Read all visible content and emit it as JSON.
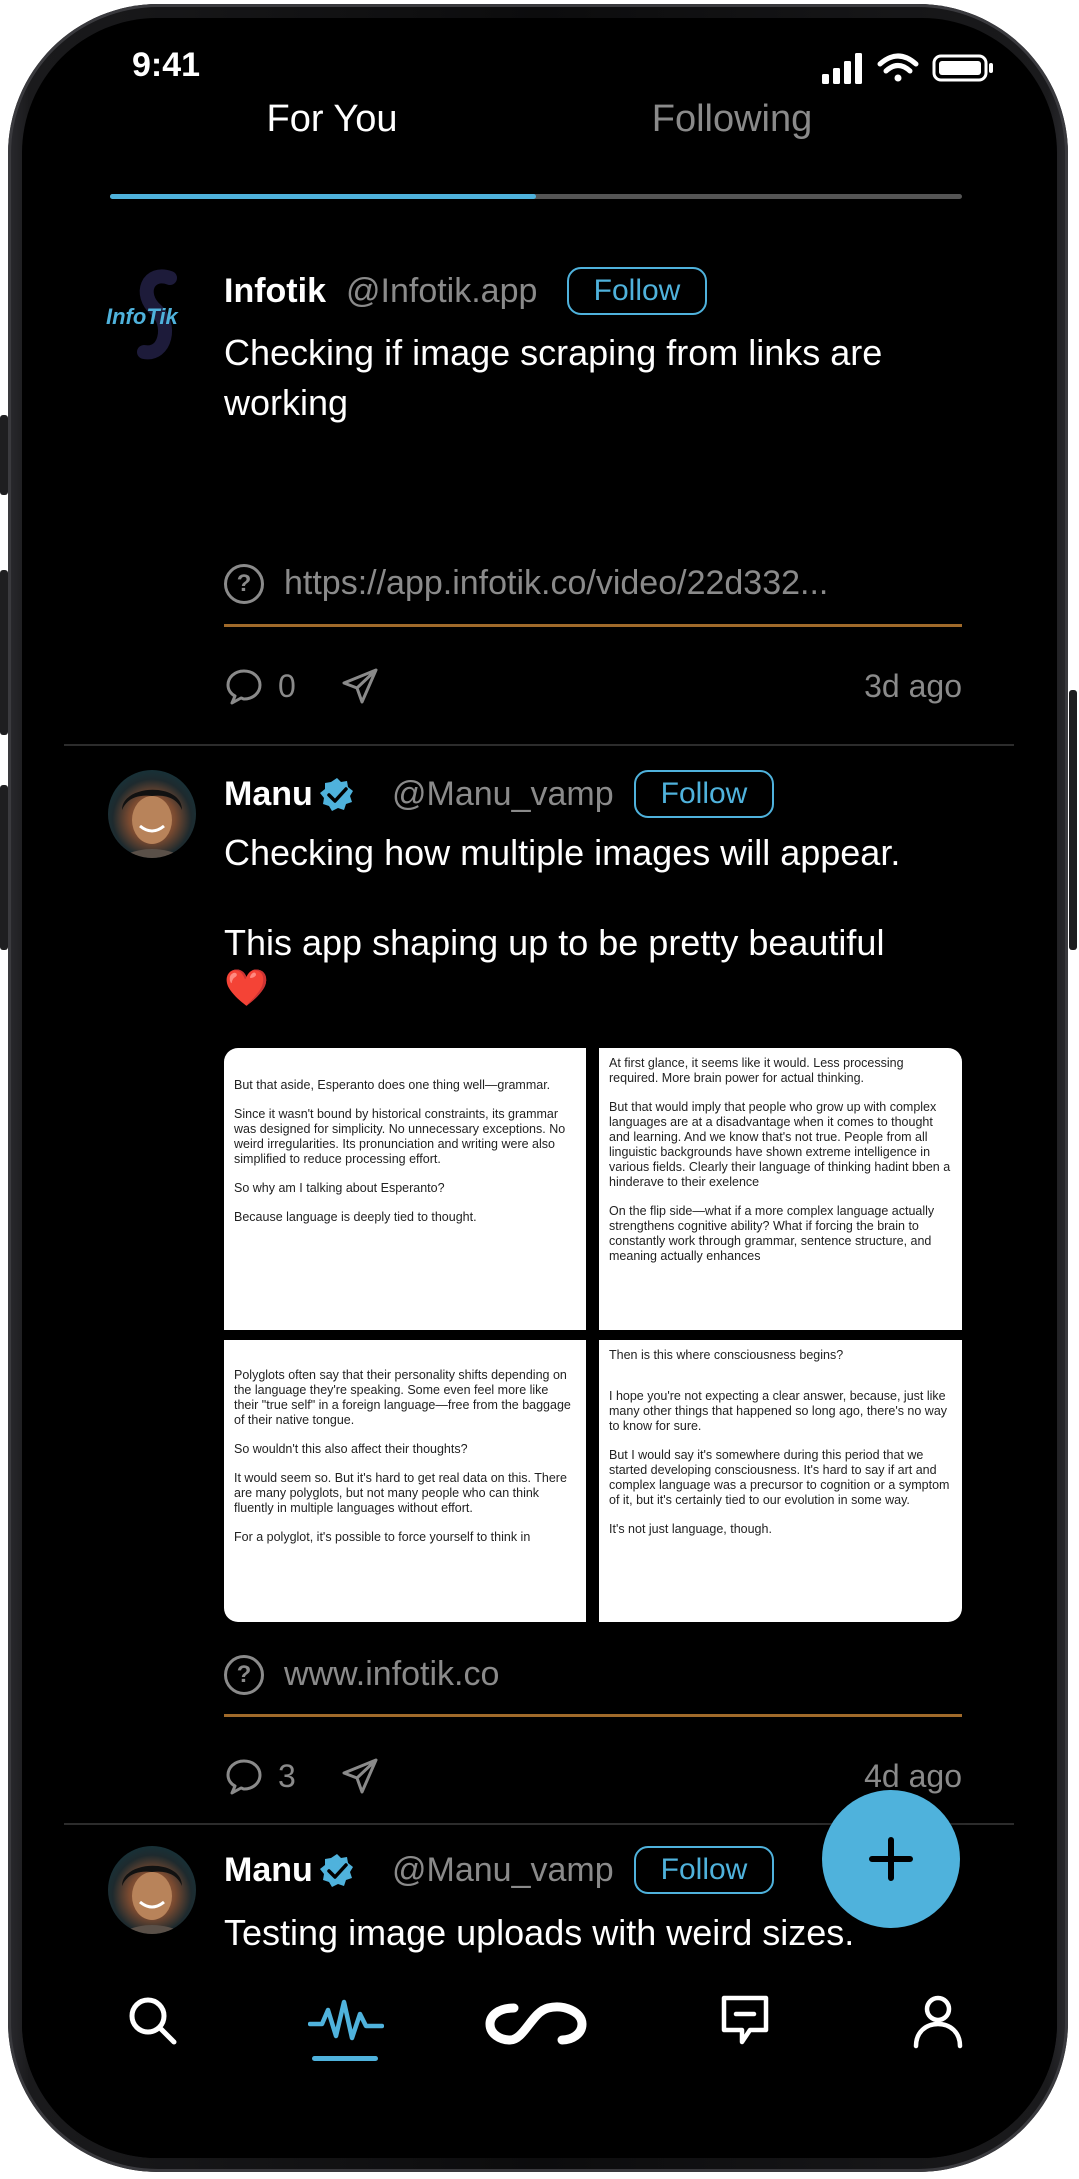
{
  "status_bar": {
    "time": "9:41"
  },
  "tabs": [
    {
      "label": "For You",
      "active": true
    },
    {
      "label": "Following",
      "active": false
    }
  ],
  "accent_color": "#4fb2dc",
  "posts": [
    {
      "logo_text": "InfoTik",
      "name": "Infotik",
      "handle": "@Infotik.app",
      "follow_label": "Follow",
      "text_lines": [
        "Checking if image scraping from links are",
        "working"
      ],
      "link": "https://app.infotik.co/video/22d332...",
      "comments": "0",
      "time_ago": "3d ago"
    },
    {
      "name": "Manu",
      "verified": true,
      "handle": "@Manu_vamp",
      "follow_label": "Follow",
      "text_lines": [
        "Checking how multiple images will appear.",
        "",
        "This app shaping up to be pretty beautiful",
        "❤️"
      ],
      "images": [
        {
          "paragraphs": [
            "But that aside, Esperanto does one thing well—grammar.",
            "Since it wasn't bound by historical constraints, its grammar was designed for simplicity. No unnecessary exceptions. No weird irregularities. Its pronunciation and writing were also simplified to reduce processing effort.",
            "So why am I talking about Esperanto?",
            "Because language is deeply tied to thought."
          ]
        },
        {
          "paragraphs": [
            "At first glance, it seems like it would. Less processing required. More brain power for actual thinking.",
            "But that would imply that people who grow up with complex languages are at a disadvantage when it comes to thought and learning. And we know that's not true. People from all linguistic backgrounds have shown extreme intelligence in various fields. Clearly their language of thinking hadint bben a hinderave to their exelence",
            "On the flip side—what if a more complex language actually strengthens cognitive ability? What if forcing the brain to constantly work through grammar, sentence structure, and meaning actually enhances"
          ]
        },
        {
          "paragraphs": [
            "Polyglots often say that their personality shifts depending on the language they're speaking. Some even feel more like their \"true self\" in a foreign language—free from the baggage of their native tongue.",
            "So wouldn't this also affect their thoughts?",
            "It would seem so. But it's hard to get real data on this. There are many polyglots, but not many people who can think fluently in multiple languages without effort.",
            "For a polyglot, it's possible to force yourself to think in"
          ]
        },
        {
          "paragraphs": [
            "Then is this where consciousness begins?",
            "I hope you're not expecting a clear answer, because, just like many other  things that happened so long ago, there's no way to know for sure.",
            "But I would say it's somewhere during this period that we started developing consciousness. It's hard to say if art and complex language was a precursor to cognition or a symptom of it, but it's certainly tied to our evolution in some way.",
            "It's not just language, though."
          ]
        }
      ],
      "link": "www.infotik.co",
      "comments": "3",
      "time_ago": "4d ago"
    },
    {
      "name": "Manu",
      "verified": true,
      "handle": "@Manu_vamp",
      "follow_label": "Follow",
      "text_lines": [
        "Testing image uploads with weird sizes."
      ]
    }
  ],
  "fab": {
    "label": "+",
    "icon": "plus-icon"
  },
  "bottom_nav": [
    {
      "icon": "search-icon",
      "active": false
    },
    {
      "icon": "pulse-feed-icon",
      "active": true
    },
    {
      "icon": "infinity-link-icon",
      "active": false
    },
    {
      "icon": "message-icon",
      "active": false
    },
    {
      "icon": "profile-icon",
      "active": false
    }
  ]
}
